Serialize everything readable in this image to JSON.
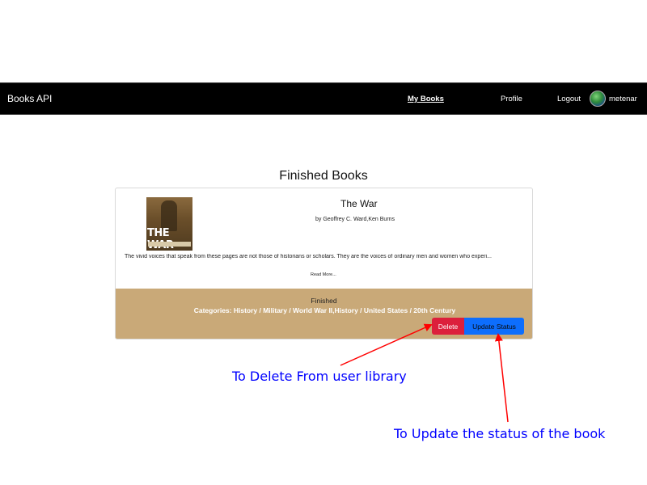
{
  "navbar": {
    "brand": "Books API",
    "links": {
      "my_books": "My Books",
      "profile": "Profile",
      "logout": "Logout"
    },
    "username": "metenar",
    "avatar_icon": "avatar-icon"
  },
  "main": {
    "section_title": "Finished Books",
    "book": {
      "cover_title": "THE WAR",
      "title": "The War",
      "authors": "by Geoffrey C. Ward,Ken Burns",
      "description": "The vivid voices that speak from these pages are not those of historians or scholars. They are the voices of ordinary men and women who experi...",
      "read_more": "Read More...",
      "status": "Finished",
      "categories": "Categories: History / Military / World War II,History / United States / 20th Century",
      "delete_label": "Delete",
      "update_label": "Update Status"
    }
  },
  "annotations": {
    "delete_note": "To Delete From user library",
    "update_note": "To Update the status of the book"
  },
  "colors": {
    "navbar_bg": "#000000",
    "footer_bg": "#c9a978",
    "delete_btn": "#dc1f3c",
    "update_btn": "#0d6efd",
    "annotation_text": "#0000ff",
    "arrow": "#ff0000"
  }
}
